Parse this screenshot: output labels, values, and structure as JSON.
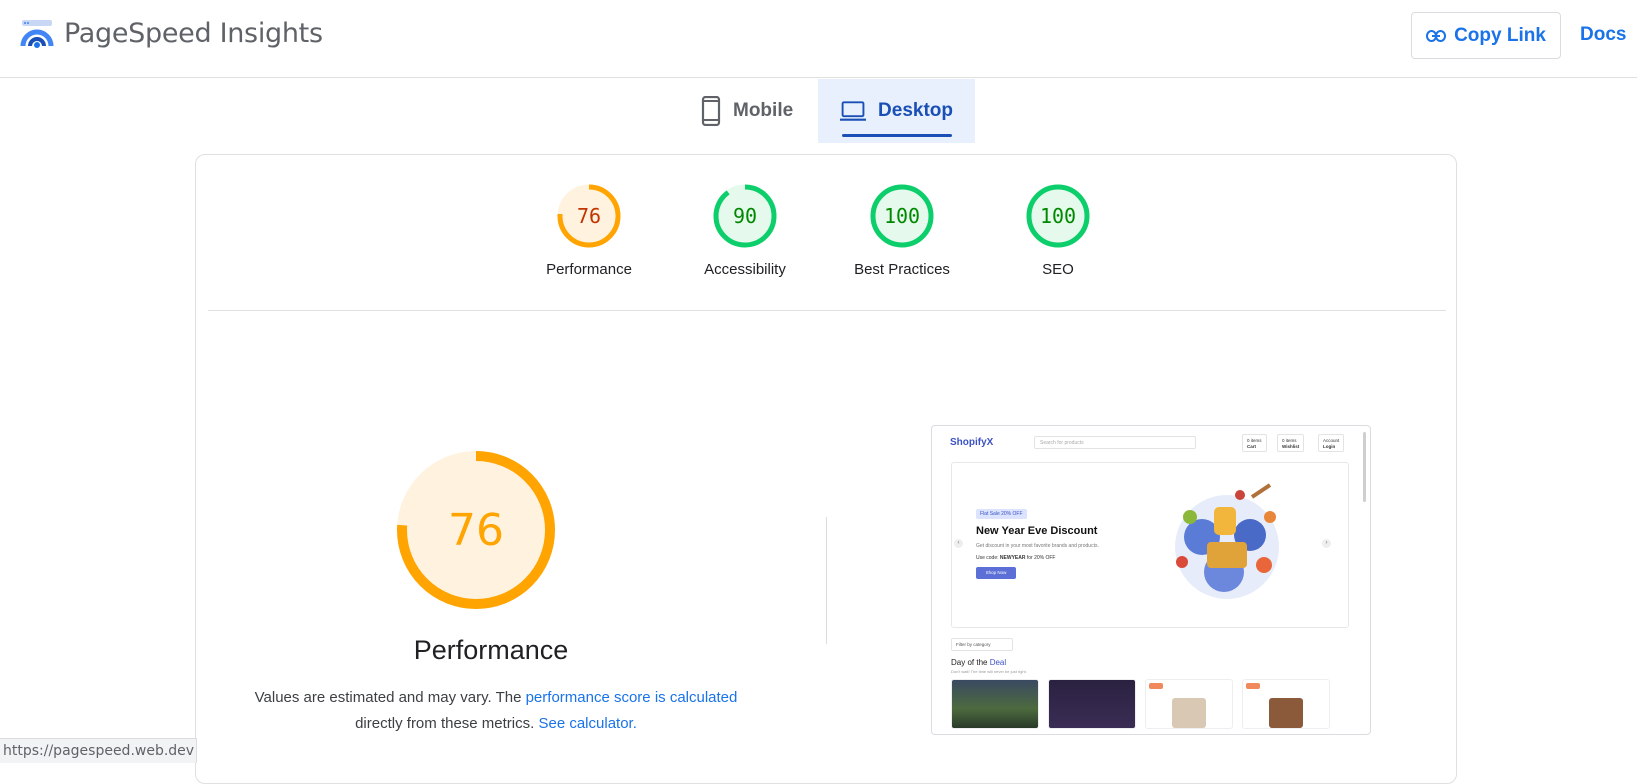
{
  "header": {
    "brand": "PageSpeed Insights",
    "copy_link": "Copy Link",
    "docs": "Docs"
  },
  "tabs": [
    {
      "label": "Mobile",
      "icon": "smartphone-icon",
      "active": false
    },
    {
      "label": "Desktop",
      "icon": "laptop-icon",
      "active": true
    }
  ],
  "scores": [
    {
      "label": "Performance",
      "value": "76",
      "score": 76,
      "status": "average"
    },
    {
      "label": "Accessibility",
      "value": "90",
      "score": 90,
      "status": "pass"
    },
    {
      "label": "Best Practices",
      "value": "100",
      "score": 100,
      "status": "pass"
    },
    {
      "label": "SEO",
      "value": "100",
      "score": 100,
      "status": "pass"
    }
  ],
  "colors": {
    "average": "#ffa400",
    "average_text": "#c33300",
    "average_fill": "#fff3e0",
    "pass": "#0cce6b",
    "pass_text": "#008800",
    "pass_fill": "#e6f9ed",
    "accent": "#1a73e8"
  },
  "performance": {
    "value": "76",
    "score": 76,
    "title": "Performance",
    "desc_1": "Values are estimated and may vary. The ",
    "link_1": "performance score is calculated",
    "desc_2": "directly from these metrics. ",
    "link_2": "See calculator."
  },
  "screenshot": {
    "logo": "ShopifyX",
    "search_placeholder": "Search for products",
    "btn_cart_1": "0 items",
    "btn_cart_2": "Cart",
    "btn_wish_1": "0 items",
    "btn_wish_2": "Wishlist",
    "btn_account_1": "Account",
    "btn_account_2": "Login",
    "badge": "Flat Sale 20% OFF",
    "headline": "New Year Eve Discount",
    "sub": "Get discount in your most favorite brands and products.",
    "code_prefix": "Use code: ",
    "code": "NEWYEAR",
    "code_suffix": " for 20% OFF",
    "shop_now": "Shop Now",
    "filter": "Filter by category",
    "deal_a": "Day of the ",
    "deal_b": "Deal",
    "deal_sub": "Don't wait! The time will never be just right.",
    "prev": "‹",
    "next": "›"
  },
  "status_bar": "https://pagespeed.web.dev"
}
